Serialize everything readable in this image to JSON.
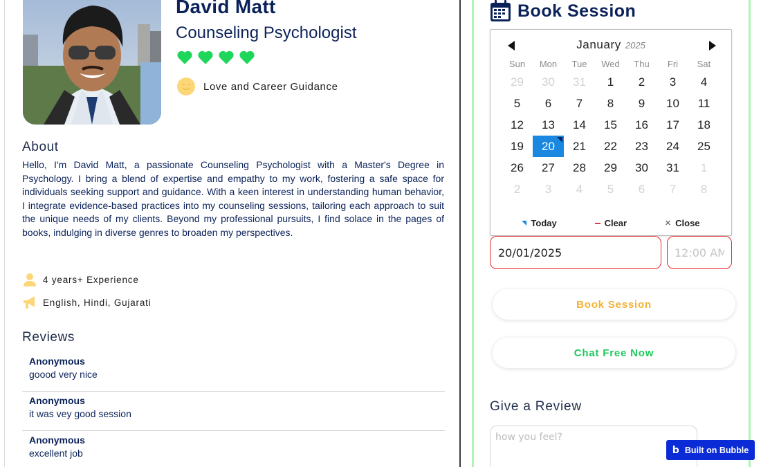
{
  "profile": {
    "name": "David Matt",
    "role": "Counseling Psychologist",
    "rating_hearts": 4,
    "specialty": "Love and Career Guidance"
  },
  "about": {
    "heading": "About",
    "text": "Hello, I'm David Matt, a passionate Counseling Psychologist with a Master's Degree in Psychology. I bring a blend of expertise and empathy to my work, fostering a safe space for individuals seeking support and guidance. With a keen interest in understanding human behavior, I integrate evidence-based practices into my counseling sessions, tailoring each approach to suit the unique needs of my clients. Beyond my professional pursuits, I find solace in the pages of books, indulging in diverse genres to broaden my perspectives."
  },
  "info": {
    "experience": "4 years+ Experience",
    "languages": "English, Hindi, Gujarati"
  },
  "reviews": {
    "heading": "Reviews",
    "items": [
      {
        "author": "Anonymous",
        "text": "goood very nice"
      },
      {
        "author": "Anonymous",
        "text": "it was vey good session"
      },
      {
        "author": "Anonymous",
        "text": "excellent job"
      }
    ]
  },
  "booking": {
    "heading": "Book Session",
    "date_value": "20/01/2025",
    "time_placeholder": "12:00 AM",
    "book_button": "Book Session",
    "chat_button": "Chat Free Now"
  },
  "calendar": {
    "month": "January",
    "year": "2025",
    "weekdays": [
      "Sun",
      "Mon",
      "Tue",
      "Wed",
      "Thu",
      "Fri",
      "Sat"
    ],
    "weeks": [
      [
        "29",
        "30",
        "31",
        "1",
        "2",
        "3",
        "4"
      ],
      [
        "5",
        "6",
        "7",
        "8",
        "9",
        "10",
        "11"
      ],
      [
        "12",
        "13",
        "14",
        "15",
        "16",
        "17",
        "18"
      ],
      [
        "19",
        "20",
        "21",
        "22",
        "23",
        "24",
        "25"
      ],
      [
        "26",
        "27",
        "28",
        "29",
        "30",
        "31",
        "1"
      ],
      [
        "2",
        "3",
        "4",
        "5",
        "6",
        "7",
        "8"
      ]
    ],
    "selected_day": "20",
    "today_label": "Today",
    "clear_label": "Clear",
    "close_label": "Close"
  },
  "give_review": {
    "heading": "Give a Review",
    "placeholder": "how you feel?"
  },
  "badge": {
    "label": "Built on Bubble"
  },
  "colors": {
    "navy": "#0b2259",
    "heart_green": "#1ed65a",
    "accent_blue": "#1a88e0",
    "orange": "#f2b233",
    "chat_green": "#1dc95a",
    "border_red": "#e02b2b",
    "panel_border": "#aef4b4",
    "bubble_blue": "#0a2bd6"
  }
}
